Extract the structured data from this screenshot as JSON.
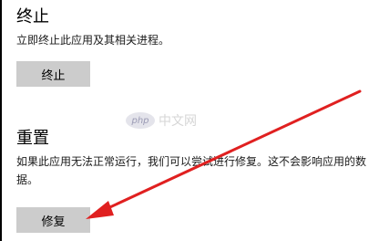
{
  "terminate": {
    "title": "终止",
    "description": "立即终止此应用及其相关进程。",
    "button_label": "终止"
  },
  "reset": {
    "title": "重置",
    "description": "如果此应用无法正常运行，我们可以尝试进行修复。这不会影响应用的数据。",
    "button_label": "修复"
  },
  "watermark": {
    "logo_text": "php",
    "site_text": "中文网"
  },
  "annotation": {
    "arrow_color": "#e02020"
  }
}
